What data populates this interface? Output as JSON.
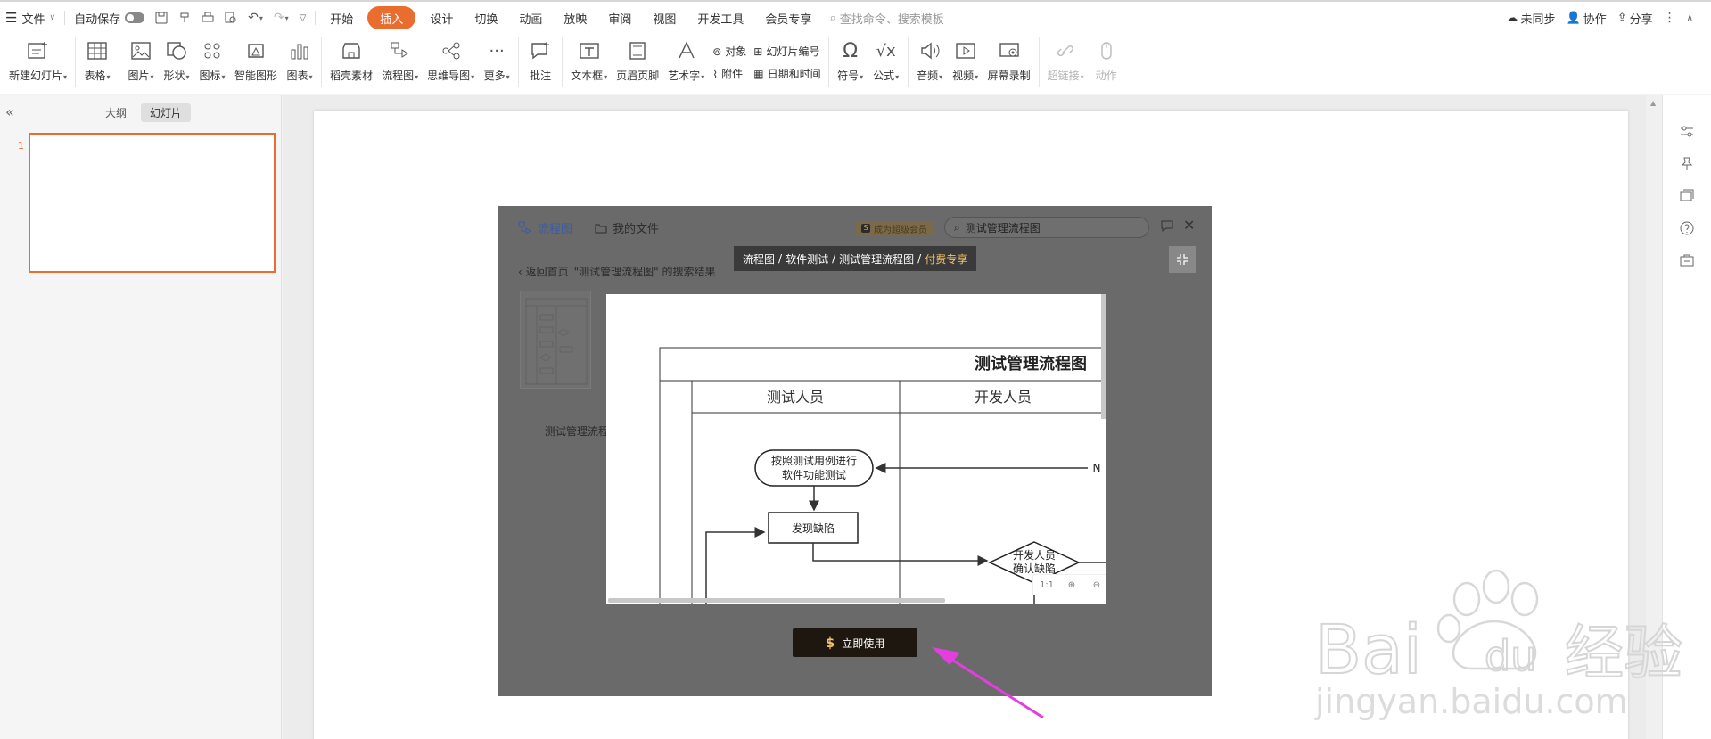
{
  "menubar": {
    "file": "文件",
    "autosave": "自动保存",
    "tabs": [
      "开始",
      "插入",
      "设计",
      "切换",
      "动画",
      "放映",
      "审阅",
      "视图",
      "开发工具",
      "会员专享"
    ],
    "active_tab": "插入",
    "search_placeholder": "查找命令、搜索模板",
    "unsync": "未同步",
    "collab": "协作",
    "share": "分享"
  },
  "ribbon": {
    "new_slide": "新建幻灯片",
    "table": "表格",
    "picture": "图片",
    "shape": "形状",
    "icon": "图标",
    "smart_graphic": "智能图形",
    "chart": "图表",
    "shell_material": "稻壳素材",
    "flowchart": "流程图",
    "mindmap": "思维导图",
    "more": "更多",
    "comment": "批注",
    "textbox": "文本框",
    "header_footer": "页眉页脚",
    "wordart": "艺术字",
    "object": "对象",
    "attachment": "附件",
    "slide_number": "幻灯片编号",
    "date_time": "日期和时间",
    "symbol": "符号",
    "formula": "公式",
    "audio": "音频",
    "video": "视频",
    "screen_record": "屏幕录制",
    "hyperlink": "超链接",
    "action": "动作"
  },
  "leftpanel": {
    "tab_outline": "大纲",
    "tab_slides": "幻灯片",
    "slide_number": "1"
  },
  "dialog": {
    "logo_label": "流程图",
    "my_files": "我的文件",
    "vip_badge": "成为超级会员",
    "search_value": "测试管理流程图",
    "back_label": "返回首页",
    "result_label": "\"测试管理流程图\" 的搜索结果",
    "thumb_label": "测试管理流程图",
    "breadcrumb": [
      "流程图",
      "软件测试",
      "测试管理流程图"
    ],
    "breadcrumb_sep": "/",
    "breadcrumb_paid": "付费专享",
    "use_button": "立即使用",
    "zoom_label": "1:1"
  },
  "flowchart": {
    "title": "测试管理流程图",
    "lane1": "测试人员",
    "lane2": "开发人员",
    "node1_line1": "按照测试用例进行",
    "node1_line2": "软件功能测试",
    "node2": "发现缺陷",
    "node3_line1": "开发人员",
    "node3_line2": "确认缺陷",
    "n_label": "N"
  },
  "watermark": {
    "brand": "Bai",
    "brand_du": "du",
    "brand_cn": "经验",
    "url": "jingyan.baidu.com"
  },
  "colors": {
    "accent": "#e96d2e",
    "annotation_arrow": "#e43ee0",
    "dialog_bg": "#6a6a6a"
  }
}
